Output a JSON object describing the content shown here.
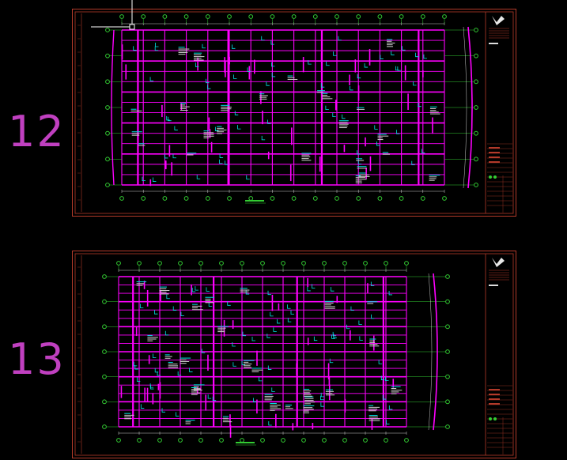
{
  "viewport": {
    "background": "#000000"
  },
  "sheets": [
    {
      "id": "sheet-12",
      "number": "12",
      "colors": {
        "frame": "#b33a2a",
        "grid": "#ff00ff",
        "axis_bubble": "#33cc33",
        "annotation": "#00e5e5",
        "dimension": "#ffffff",
        "title_block": "#b33a2a"
      }
    },
    {
      "id": "sheet-13",
      "number": "13",
      "colors": {
        "frame": "#b33a2a",
        "grid": "#ff00ff",
        "axis_bubble": "#33cc33",
        "annotation": "#00e5e5",
        "dimension": "#ffffff",
        "title_block": "#b33a2a"
      }
    }
  ],
  "cursor": {
    "icon": "crosshair-cursor-icon",
    "color": "#ffffff"
  }
}
